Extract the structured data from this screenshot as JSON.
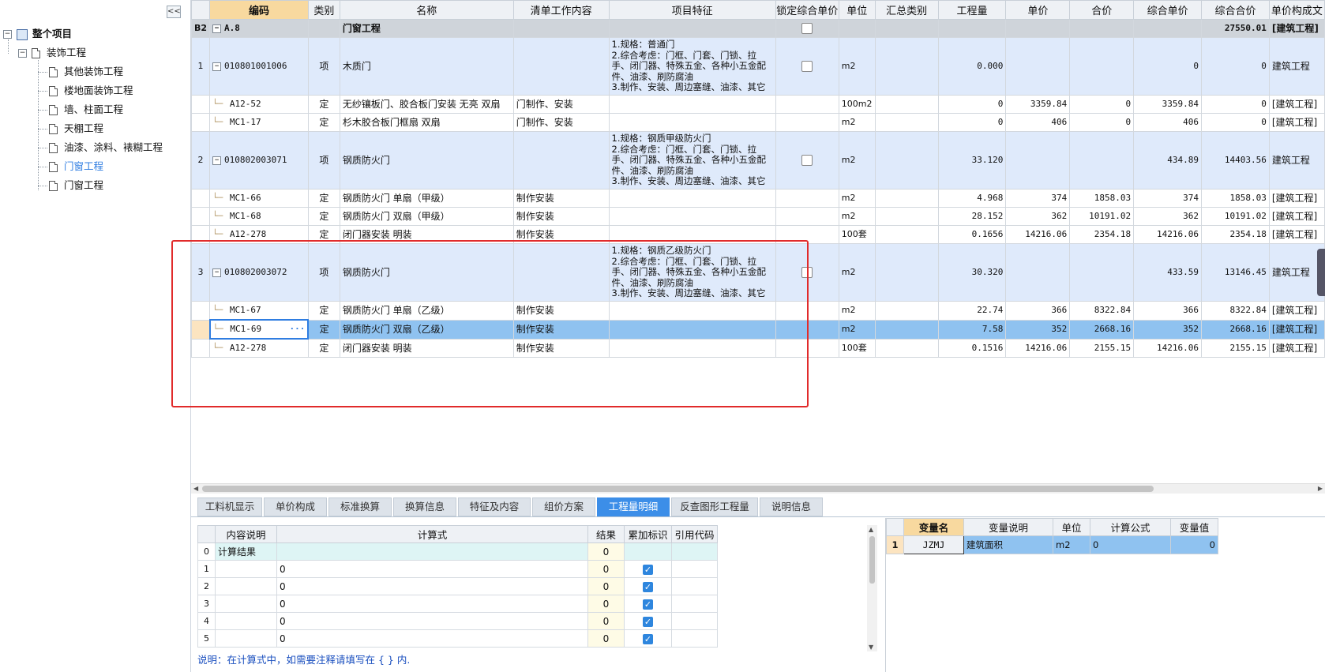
{
  "tree": {
    "collapse_label": "<<",
    "items": [
      {
        "label": "整个项目",
        "level": 0
      },
      {
        "label": "装饰工程",
        "level": 1
      },
      {
        "label": "其他装饰工程",
        "level": 2
      },
      {
        "label": "楼地面装饰工程",
        "level": 2
      },
      {
        "label": "墙、柱面工程",
        "level": 2
      },
      {
        "label": "天棚工程",
        "level": 2
      },
      {
        "label": "油漆、涂料、裱糊工程",
        "level": 2
      },
      {
        "label": "门窗工程",
        "level": 2,
        "selected": true
      },
      {
        "label": "门窗工程",
        "level": 2
      }
    ]
  },
  "grid": {
    "columns": [
      "",
      "编码",
      "类别",
      "名称",
      "清单工作内容",
      "项目特征",
      "锁定综合单价",
      "单位",
      "汇总类别",
      "工程量",
      "单价",
      "合价",
      "综合单价",
      "综合合价",
      "单价构成文"
    ],
    "rows": [
      {
        "kind": "chapter",
        "no": "B2",
        "code": "A.8",
        "type": "",
        "name": "门窗工程",
        "work": "",
        "feature": "",
        "lock": true,
        "unit": "",
        "sum": "",
        "qty": "",
        "price": "",
        "total": "",
        "cprice": "",
        "ctotal": "27550.01",
        "comp": "[建筑工程]"
      },
      {
        "kind": "item",
        "no": "1",
        "code": "010801001006",
        "type": "项",
        "name": "木质门",
        "work": "",
        "feature": "1.规格：普通门\n2.综合考虑：门框、门套、门锁、拉手、闭门器、特殊五金、各种小五金配件、油漆、刷防腐油\n3.制作、安装、周边塞缝、油漆、其它",
        "lock": true,
        "unit": "m2",
        "sum": "",
        "qty": "0.000",
        "price": "",
        "total": "",
        "cprice": "0",
        "ctotal": "0",
        "comp": "建筑工程"
      },
      {
        "kind": "quota",
        "no": "",
        "code": "A12-52",
        "type": "定",
        "name": "无纱镶板门、胶合板门安装 无亮 双扇",
        "work": "门制作、安装",
        "feature": "",
        "lock": false,
        "unit": "100m2",
        "sum": "",
        "qty": "0",
        "price": "3359.84",
        "total": "0",
        "cprice": "3359.84",
        "ctotal": "0",
        "comp": "[建筑工程]"
      },
      {
        "kind": "quota",
        "no": "",
        "code": "MC1-17",
        "type": "定",
        "name": "杉木胶合板门框扇 双扇",
        "work": "门制作、安装",
        "feature": "",
        "lock": false,
        "unit": "m2",
        "sum": "",
        "qty": "0",
        "price": "406",
        "total": "0",
        "cprice": "406",
        "ctotal": "0",
        "comp": "[建筑工程]"
      },
      {
        "kind": "item",
        "no": "2",
        "code": "010802003071",
        "type": "项",
        "name": "钢质防火门",
        "work": "",
        "feature": "1.规格：钢质甲级防火门\n2.综合考虑：门框、门套、门锁、拉手、闭门器、特殊五金、各种小五金配件、油漆、刷防腐油\n3.制作、安装、周边塞缝、油漆、其它",
        "lock": true,
        "unit": "m2",
        "sum": "",
        "qty": "33.120",
        "price": "",
        "total": "",
        "cprice": "434.89",
        "ctotal": "14403.56",
        "comp": "建筑工程"
      },
      {
        "kind": "quota",
        "no": "",
        "code": "MC1-66",
        "type": "定",
        "name": "钢质防火门 单扇（甲级）",
        "work": "制作安装",
        "feature": "",
        "lock": false,
        "unit": "m2",
        "sum": "",
        "qty": "4.968",
        "price": "374",
        "total": "1858.03",
        "cprice": "374",
        "ctotal": "1858.03",
        "comp": "[建筑工程]"
      },
      {
        "kind": "quota",
        "no": "",
        "code": "MC1-68",
        "type": "定",
        "name": "钢质防火门 双扇（甲级）",
        "work": "制作安装",
        "feature": "",
        "lock": false,
        "unit": "m2",
        "sum": "",
        "qty": "28.152",
        "price": "362",
        "total": "10191.02",
        "cprice": "362",
        "ctotal": "10191.02",
        "comp": "[建筑工程]"
      },
      {
        "kind": "quota",
        "no": "",
        "code": "A12-278",
        "type": "定",
        "name": "闭门器安装 明装",
        "work": "制作安装",
        "feature": "",
        "lock": false,
        "unit": "100套",
        "sum": "",
        "qty": "0.1656",
        "price": "14216.06",
        "total": "2354.18",
        "cprice": "14216.06",
        "ctotal": "2354.18",
        "comp": "[建筑工程]"
      },
      {
        "kind": "item",
        "no": "3",
        "code": "010802003072",
        "type": "项",
        "name": "钢质防火门",
        "work": "",
        "feature": "1.规格：钢质乙级防火门\n2.综合考虑：门框、门套、门锁、拉手、闭门器、特殊五金、各种小五金配件、油漆、刷防腐油\n3.制作、安装、周边塞缝、油漆、其它",
        "lock": true,
        "unit": "m2",
        "sum": "",
        "qty": "30.320",
        "price": "",
        "total": "",
        "cprice": "433.59",
        "ctotal": "13146.45",
        "comp": "建筑工程"
      },
      {
        "kind": "quota",
        "no": "",
        "code": "MC1-67",
        "type": "定",
        "name": "钢质防火门 单扇（乙级）",
        "work": "制作安装",
        "feature": "",
        "lock": false,
        "unit": "m2",
        "sum": "",
        "qty": "22.74",
        "price": "366",
        "total": "8322.84",
        "cprice": "366",
        "ctotal": "8322.84",
        "comp": "[建筑工程]"
      },
      {
        "kind": "selected",
        "no": "",
        "code": "MC1-69",
        "type": "定",
        "name": "钢质防火门 双扇（乙级）",
        "work": "制作安装",
        "feature": "",
        "lock": false,
        "unit": "m2",
        "sum": "",
        "qty": "7.58",
        "price": "352",
        "total": "2668.16",
        "cprice": "352",
        "ctotal": "2668.16",
        "comp": "[建筑工程]"
      },
      {
        "kind": "quota",
        "no": "",
        "code": "A12-278",
        "type": "定",
        "name": "闭门器安装 明装",
        "work": "制作安装",
        "feature": "",
        "lock": false,
        "unit": "100套",
        "sum": "",
        "qty": "0.1516",
        "price": "14216.06",
        "total": "2155.15",
        "cprice": "14216.06",
        "ctotal": "2155.15",
        "comp": "[建筑工程]"
      }
    ]
  },
  "tabs": [
    {
      "label": "工料机显示"
    },
    {
      "label": "单价构成"
    },
    {
      "label": "标准换算"
    },
    {
      "label": "换算信息"
    },
    {
      "label": "特征及内容"
    },
    {
      "label": "组价方案"
    },
    {
      "label": "工程量明细",
      "active": true
    },
    {
      "label": "反查图形工程量"
    },
    {
      "label": "说明信息"
    }
  ],
  "calc": {
    "columns": [
      "",
      "内容说明",
      "计算式",
      "结果",
      "累加标识",
      "引用代码"
    ],
    "rows": [
      {
        "no": "0",
        "desc": "计算结果",
        "formula": "",
        "result": "0",
        "acc": false,
        "ref": ""
      },
      {
        "no": "1",
        "desc": "",
        "formula": "0",
        "result": "0",
        "acc": true,
        "ref": ""
      },
      {
        "no": "2",
        "desc": "",
        "formula": "0",
        "result": "0",
        "acc": true,
        "ref": ""
      },
      {
        "no": "3",
        "desc": "",
        "formula": "0",
        "result": "0",
        "acc": true,
        "ref": ""
      },
      {
        "no": "4",
        "desc": "",
        "formula": "0",
        "result": "0",
        "acc": true,
        "ref": ""
      },
      {
        "no": "5",
        "desc": "",
        "formula": "0",
        "result": "0",
        "acc": true,
        "ref": ""
      }
    ],
    "note": "说明：在计算式中，如需要注释请填写在 { } 内."
  },
  "vars": {
    "columns": [
      "",
      "变量名",
      "变量说明",
      "单位",
      "计算公式",
      "变量值"
    ],
    "rows": [
      {
        "no": "1",
        "name": "JZMJ",
        "desc": "建筑面积",
        "unit": "m2",
        "formula": "0",
        "value": "0"
      }
    ]
  },
  "colors": {
    "accent": "#3c8ee8",
    "selected_row": "#8fc2f0",
    "item_row": "#dfeafb",
    "highlight_box": "#e12b2b"
  }
}
